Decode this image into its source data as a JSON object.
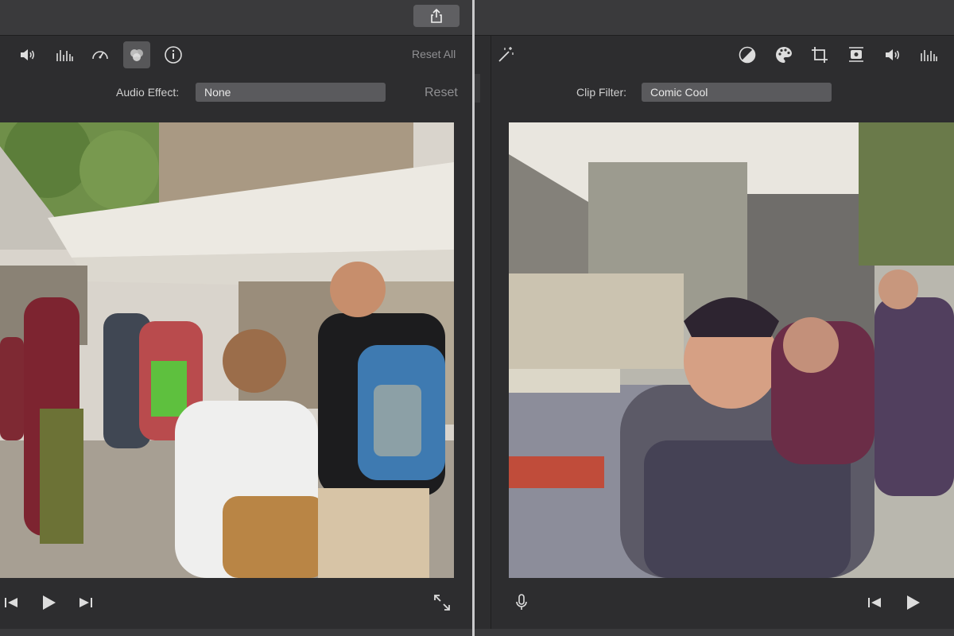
{
  "left": {
    "toolbar": {
      "icons": [
        "volume-icon",
        "equalizer-icon",
        "speed-icon",
        "color-filter-icon",
        "info-icon"
      ],
      "reset_all_label": "Reset All"
    },
    "audio_effect": {
      "label": "Audio Effect:",
      "value": "None",
      "reset_label": "Reset"
    },
    "playback": {
      "icons": [
        "skip-back-icon",
        "play-icon",
        "skip-forward-icon",
        "fullscreen-icon"
      ]
    }
  },
  "right": {
    "toolbar": {
      "icons": [
        "magic-wand-icon",
        "color-balance-icon",
        "color-palette-icon",
        "crop-icon",
        "stabilization-camera-icon",
        "volume-icon",
        "equalizer-icon"
      ]
    },
    "clip_filter": {
      "label": "Clip Filter:",
      "value": "Comic Cool"
    },
    "playback": {
      "icons": [
        "microphone-icon",
        "skip-back-icon",
        "play-icon"
      ]
    }
  },
  "colors": {
    "panel_bg": "#2d2d2f",
    "topbar_bg": "#3a3a3c",
    "select_bg": "#5a5a5d",
    "text": "#cfcfcf"
  }
}
